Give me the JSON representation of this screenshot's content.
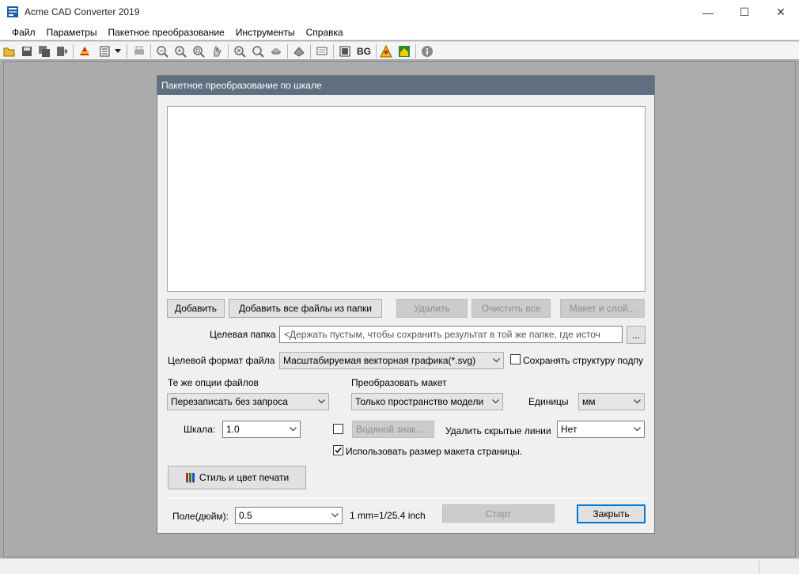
{
  "window": {
    "title": "Acme CAD Converter 2019",
    "controls": {
      "minimize": "—",
      "maximize": "☐",
      "close": "✕"
    }
  },
  "menu": [
    "Файл",
    "Параметры",
    "Пакетное преобразование",
    "Инструменты",
    "Справка"
  ],
  "toolbar": {
    "bg_label": "BG"
  },
  "dialog": {
    "title": "Пакетное преобразование по шкале",
    "buttons": {
      "add": "Добавить",
      "add_folder": "Добавить все файлы из папки",
      "delete": "Удалить",
      "clear_all": "Очистить все",
      "layout_layers": "Макет и слой...",
      "browse": "...",
      "print_style": "Стиль и цвет печати",
      "start": "Старт",
      "close": "Закрыть",
      "watermark": "Водяной знак..."
    },
    "target_folder": {
      "label": "Целевая папка",
      "placeholder": "<Держать пустым, чтобы сохранить результат в той же папке, где источ"
    },
    "target_format": {
      "label": "Целевой формат файла",
      "value": "Масштабируемая векторная графика(*.svg)"
    },
    "keep_structure": {
      "label": "Сохранять структуру подпу",
      "checked": false
    },
    "same_file_options": {
      "label": "Те же опции файлов",
      "value": "Перезаписать без запроса"
    },
    "convert_layout": {
      "label": "Преобразовать макет",
      "value": "Только пространство модели"
    },
    "units": {
      "label": "Единицы",
      "value": "мм"
    },
    "scale": {
      "label": "Шкала:",
      "value": "1.0"
    },
    "watermark_checked": false,
    "remove_hidden": {
      "label": "Удалить скрытые линии",
      "value": "Нет"
    },
    "use_page_size": {
      "label": "Использовать размер макета страницы.",
      "checked": true
    },
    "margin": {
      "label": "Поле(дюйм):",
      "value": "0.5"
    },
    "ratio": "1 mm=1/25.4 inch"
  }
}
